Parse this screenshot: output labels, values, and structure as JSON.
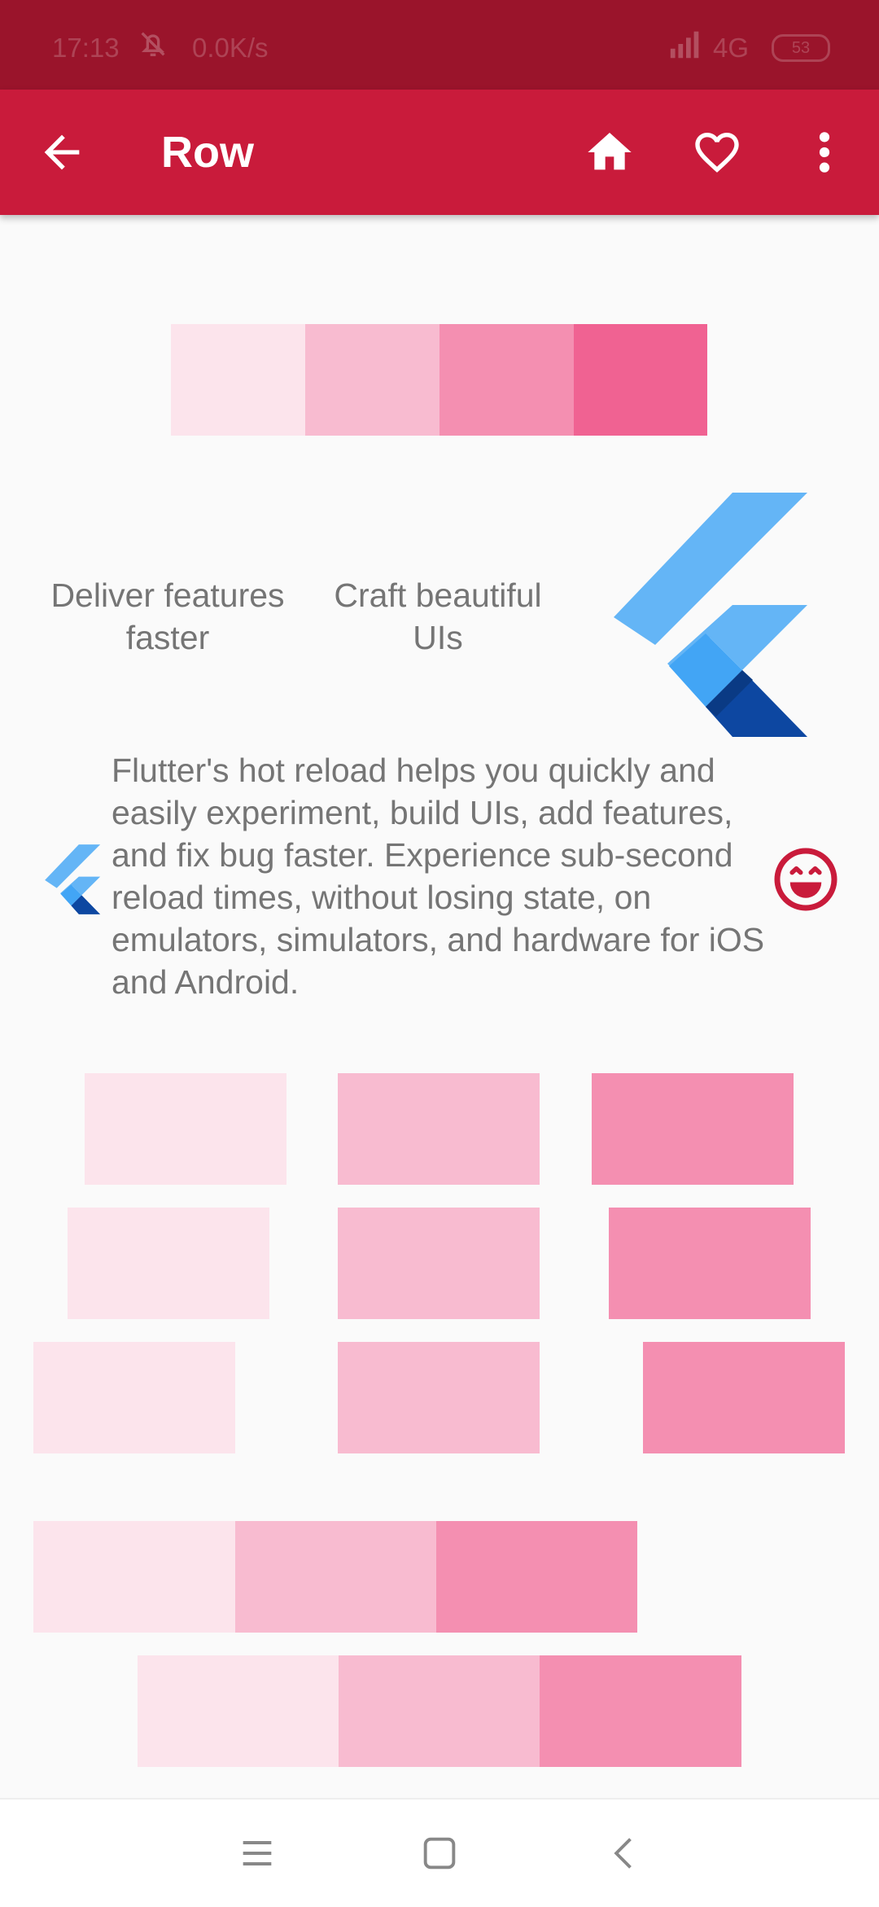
{
  "status_bar": {
    "time": "17:13",
    "speed": "0.0K/s",
    "network": "4G",
    "battery": "53"
  },
  "app_bar": {
    "title": "Row",
    "icons": [
      "arrow-back-icon",
      "home-icon",
      "heart-icon",
      "more-vert-icon"
    ]
  },
  "section2": {
    "col1": [
      "Deliver features",
      "faster"
    ],
    "col2": [
      "Craft beautiful",
      "UIs"
    ]
  },
  "section3": {
    "paragraph": "Flutter's hot reload helps you quickly and easily experiment, build UIs, add features, and fix bug faster. Experience sub-second reload times, without losing state, on emulators, simulators, and hardware for iOS and Android."
  },
  "colors": {
    "status_bar": "#9A142B",
    "app_bar": "#C91B3B",
    "pink_50": "#FCE4EC",
    "pink_100": "#F8BBD0",
    "pink_200": "#F48FB1",
    "pink_300": "#F06292",
    "text_grey": "#757575",
    "accent": "#C91B3B"
  },
  "system_nav": {
    "icons": [
      "menu-icon",
      "home-square-icon",
      "back-chevron-icon"
    ]
  }
}
